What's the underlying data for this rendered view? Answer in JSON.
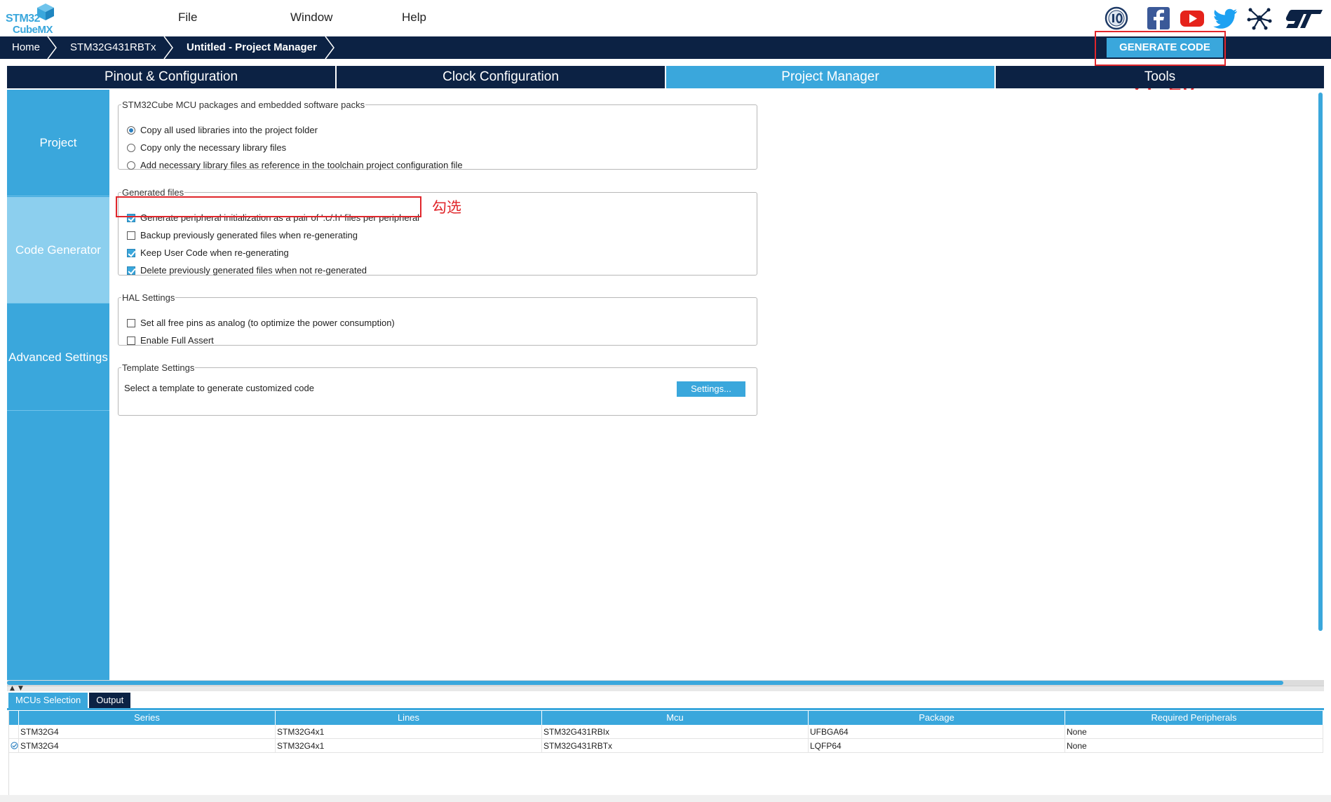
{
  "app": {
    "logo_top": "STM32",
    "logo_bottom": "CubeMX"
  },
  "menu": {
    "file": "File",
    "window": "Window",
    "help": "Help"
  },
  "social_icons": [
    "anniversary-10-icon",
    "facebook-icon",
    "youtube-icon",
    "twitter-icon",
    "network-icon",
    "st-logo-icon"
  ],
  "breadcrumb": {
    "home": "Home",
    "mcu": "STM32G431RBTx",
    "project": "Untitled - Project Manager"
  },
  "toolbar": {
    "generate_label": "GENERATE CODE"
  },
  "annotations": {
    "generate_note": "生成",
    "check_note": "勾选"
  },
  "colors": {
    "accent": "#3aa7dc",
    "navy": "#0c2244",
    "annotation_red": "#e0262b"
  },
  "tabs": [
    {
      "label": "Pinout & Configuration"
    },
    {
      "label": "Clock Configuration"
    },
    {
      "label": "Project Manager",
      "active": true
    },
    {
      "label": "Tools"
    }
  ],
  "side": {
    "items": [
      {
        "label": "Project"
      },
      {
        "label": "Code Generator",
        "active": true
      },
      {
        "label": "Advanced Settings"
      }
    ]
  },
  "groups": {
    "packages": {
      "legend": "STM32Cube MCU packages and embedded software packs",
      "options": [
        {
          "label": "Copy all used libraries into the project folder",
          "selected": true
        },
        {
          "label": "Copy only the necessary library files",
          "selected": false
        },
        {
          "label": "Add necessary library files as reference in the toolchain project configuration file",
          "selected": false
        }
      ]
    },
    "generated": {
      "legend": "Generated files",
      "options": [
        {
          "label": "Generate peripheral initialization as a pair of '.c/.h' files per peripheral",
          "checked": true
        },
        {
          "label": "Backup previously generated files when re-generating",
          "checked": false
        },
        {
          "label": "Keep User Code when re-generating",
          "checked": true
        },
        {
          "label": "Delete previously generated files when not re-generated",
          "checked": true
        }
      ]
    },
    "hal": {
      "legend": "HAL Settings",
      "options": [
        {
          "label": "Set all free pins as analog (to optimize the power consumption)",
          "checked": false
        },
        {
          "label": "Enable Full Assert",
          "checked": false
        }
      ]
    },
    "template": {
      "legend": "Template Settings",
      "text": "Select a template to generate customized code",
      "button": "Settings..."
    }
  },
  "bottom": {
    "tabs": [
      {
        "label": "MCUs Selection"
      },
      {
        "label": "Output"
      }
    ],
    "columns": [
      "Series",
      "Lines",
      "Mcu",
      "Package",
      "Required Peripherals"
    ],
    "rows": [
      {
        "series": "STM32G4",
        "lines": "STM32G4x1",
        "mcu": "STM32G431RBIx",
        "package": "UFBGA64",
        "peripherals": "None",
        "selected": false
      },
      {
        "series": "STM32G4",
        "lines": "STM32G4x1",
        "mcu": "STM32G431RBTx",
        "package": "LQFP64",
        "peripherals": "None",
        "selected": true
      }
    ]
  }
}
